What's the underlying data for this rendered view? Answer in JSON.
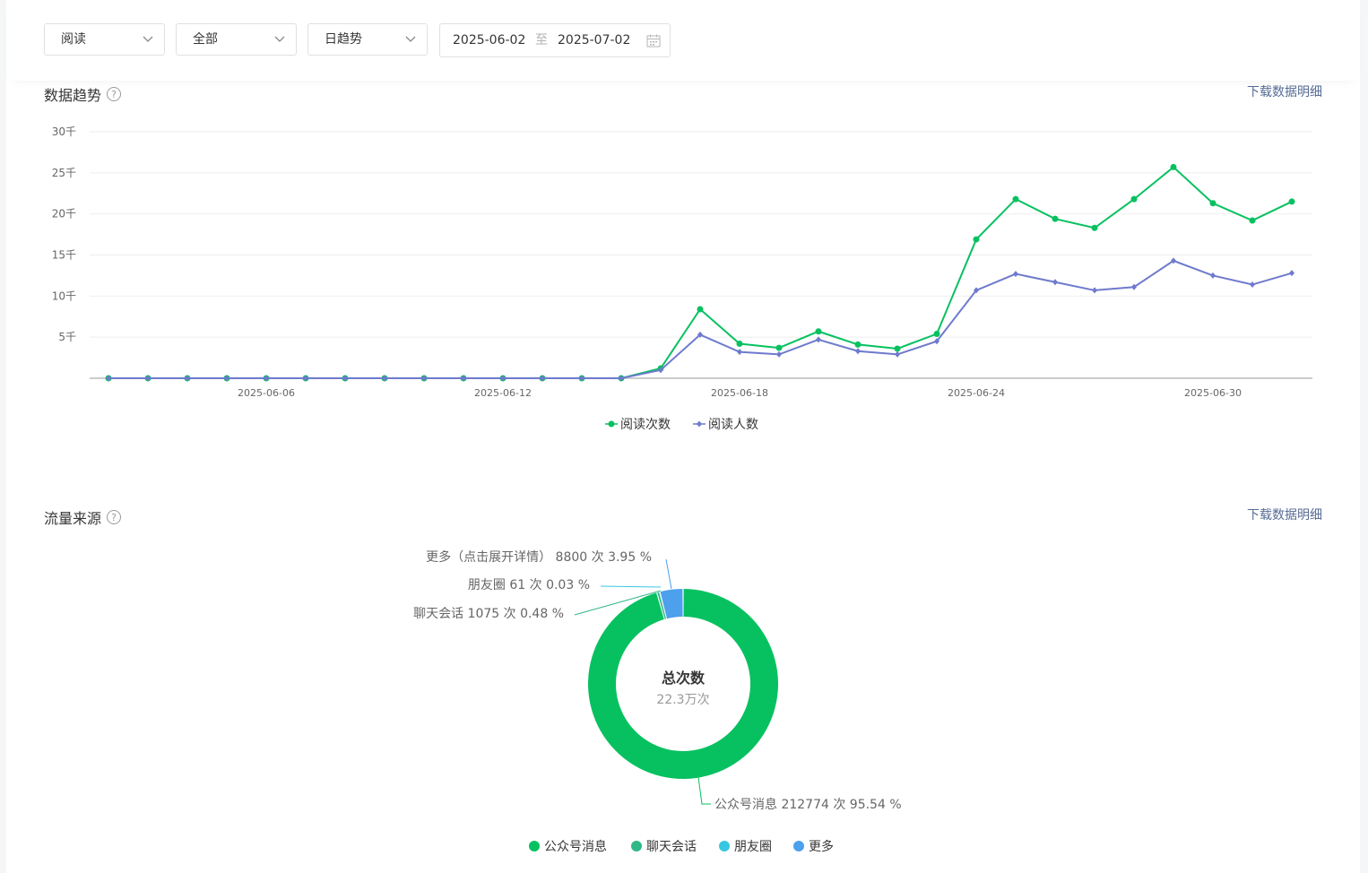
{
  "filters": {
    "metric": "阅读",
    "scope": "全部",
    "granularity": "日趋势",
    "date_start": "2025-06-02",
    "date_sep": "至",
    "date_end": "2025-07-02"
  },
  "trend": {
    "title": "数据趋势",
    "download": "下载数据明细"
  },
  "traffic": {
    "title": "流量来源",
    "download": "下载数据明细"
  },
  "colors": {
    "green": "#07c160",
    "purple": "#6e7acd",
    "teal": "#30b886",
    "cyan": "#38c7e0",
    "blue": "#4ca0ec"
  },
  "chart_data": [
    {
      "type": "line",
      "y_ticks": [
        "30千",
        "25千",
        "20千",
        "15千",
        "10千",
        "5千"
      ],
      "y_tick_values": [
        30000,
        25000,
        20000,
        15000,
        10000,
        5000
      ],
      "ylim": [
        0,
        30000
      ],
      "x": [
        "2025-06-02",
        "2025-06-03",
        "2025-06-04",
        "2025-06-05",
        "2025-06-06",
        "2025-06-07",
        "2025-06-08",
        "2025-06-09",
        "2025-06-10",
        "2025-06-11",
        "2025-06-12",
        "2025-06-13",
        "2025-06-14",
        "2025-06-15",
        "2025-06-16",
        "2025-06-17",
        "2025-06-18",
        "2025-06-19",
        "2025-06-20",
        "2025-06-21",
        "2025-06-22",
        "2025-06-23",
        "2025-06-24",
        "2025-06-25",
        "2025-06-26",
        "2025-06-27",
        "2025-06-28",
        "2025-06-29",
        "2025-06-30",
        "2025-07-01",
        "2025-07-02"
      ],
      "x_tick_labels": [
        "2025-06-06",
        "2025-06-12",
        "2025-06-18",
        "2025-06-24",
        "2025-06-30"
      ],
      "grid": true,
      "legend": "bottom",
      "series": [
        {
          "name": "阅读次数",
          "color": "#07c160",
          "marker": "circle",
          "values": [
            0,
            0,
            0,
            0,
            0,
            0,
            0,
            0,
            0,
            0,
            0,
            0,
            0,
            0,
            1200,
            8400,
            4200,
            3700,
            5700,
            4100,
            3600,
            5400,
            16900,
            21800,
            19400,
            18300,
            21800,
            25700,
            21300,
            19200,
            21500
          ]
        },
        {
          "name": "阅读人数",
          "color": "#6e7acd",
          "marker": "diamond",
          "values": [
            0,
            0,
            0,
            0,
            0,
            0,
            0,
            0,
            0,
            0,
            0,
            0,
            0,
            0,
            1000,
            5300,
            3200,
            2900,
            4700,
            3300,
            2900,
            4500,
            10700,
            12700,
            11700,
            10700,
            11100,
            14300,
            12500,
            11400,
            12800
          ]
        }
      ]
    },
    {
      "type": "pie",
      "style": "donut",
      "center_title": "总次数",
      "center_value": "22.3万次",
      "legend": "bottom",
      "slices": [
        {
          "name": "公众号消息",
          "value": 212774,
          "percent": 95.54,
          "color": "#07c160",
          "label": "公众号消息 212774 次 95.54 %"
        },
        {
          "name": "聊天会话",
          "value": 1075,
          "percent": 0.48,
          "color": "#30b886",
          "label": "聊天会话 1075 次 0.48 %"
        },
        {
          "name": "朋友圈",
          "value": 61,
          "percent": 0.03,
          "color": "#38c7e0",
          "label": "朋友圈 61 次 0.03 %"
        },
        {
          "name": "更多",
          "value": 8800,
          "percent": 3.95,
          "color": "#4ca0ec",
          "label": "更多（点击展开详情） 8800 次 3.95 %"
        }
      ]
    }
  ]
}
